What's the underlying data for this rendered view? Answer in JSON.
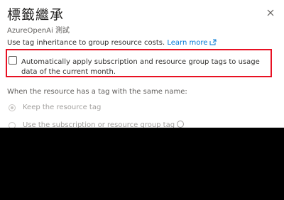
{
  "dialog": {
    "title": "標籤繼承",
    "subtitle": "AzureOpenAi 測試",
    "description": "Use tag inheritance to group resource costs.",
    "learn_more": "Learn more",
    "checkbox_label": "Automatically apply subscription and resource group tags to usage data of the current month.",
    "checkbox_checked": false,
    "section_label": "When the resource has a tag with the same name:",
    "options": [
      {
        "label": "Keep the resource tag",
        "selected": true
      },
      {
        "label": "Use the subscription or resource group tag",
        "selected": false
      }
    ],
    "highlight_color": "#e81123",
    "link_color": "#0078d4"
  },
  "icons": {
    "close": "close-icon",
    "external_link": "external-link-icon",
    "info": "info-icon"
  }
}
